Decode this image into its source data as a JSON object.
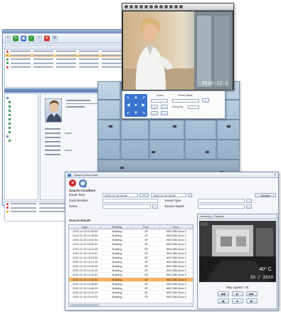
{
  "search_window": {
    "title": "Search Video Data",
    "search_condition_label": "Search Condition",
    "event_time_label": "Event Time",
    "time_from": "2010-12-15  00:00",
    "time_to": "2010-12-15  23:59",
    "card_number_label": "Card Number",
    "event_type_label": "Event Type",
    "name_label": "Name",
    "device_name_label": "Device Name",
    "search_button": "Search",
    "search_result_label": "Search Result",
    "columns": [
      "Date",
      "Building",
      "Floor",
      "Door"
    ],
    "rows": [
      [
        "2010-12-15 11:06:34",
        "Building",
        "GF",
        "IHDC380-Door 0"
      ],
      [
        "2010-12-15 11:06:59",
        "Building",
        "GF",
        "IHDC380-Door 0"
      ],
      [
        "2010-12-15 13:51:34",
        "Building",
        "GF",
        "IHDC380-Door 0"
      ],
      [
        "2010-12-15 13:51:34",
        "Building",
        "GF",
        "IHDC380-Door 0"
      ],
      [
        "2010-12-15 13:11:45",
        "Building",
        "GF",
        "IHDC380-Door 0"
      ],
      [
        "2010-12-15 13:13:51",
        "Building",
        "GF",
        "IHDC380-Door 0"
      ],
      [
        "2010-12-15 13:13:59",
        "Building",
        "GF",
        "IHDC380-Door 0"
      ],
      [
        "2010-12-15 13:17:19",
        "Building",
        "GF",
        "IHDC380-Door 0"
      ],
      [
        "2010-12-15 14:28:44",
        "Building",
        "GF",
        "IHDC380-Door 0"
      ],
      [
        "2010-12-15 14:31:44",
        "Building",
        "GF",
        "IHDC380-Door 0"
      ],
      [
        "2010-12-15 14:31:52",
        "Building",
        "GF",
        "IHDC380-Door 0"
      ],
      [
        "2010-12-15 14:31:52",
        "Building",
        "GF",
        "IHDC380-Door 0"
      ],
      [
        "2010-12-15 14:46:09",
        "Building",
        "GF",
        "IHDC380-Door 0"
      ],
      [
        "2010-12-15 14:46:13",
        "Building",
        "GF",
        "IHDC380-Door 0"
      ],
      [
        "2010-12-15 15:01:19",
        "Building",
        "GF",
        "IHDC380-Door 0"
      ],
      [
        "2010-12-15 16:01:03",
        "Building",
        "GF",
        "IHDC380-Door 0"
      ]
    ],
    "selected_row": 11
  },
  "playback": {
    "title": "Camera(c) - Playback",
    "temperature": "40° C",
    "clock": "33 / 2010",
    "play_speed": "Play Speed : x0",
    "controls_row1": [
      "◀◀",
      "▶",
      "▶▶"
    ],
    "controls_row2": [
      "◀|",
      "■",
      "|▶"
    ]
  },
  "video": {
    "timestamp": "2010-12-1"
  },
  "ptz": {
    "speed_label": "Speed",
    "preset_label": "Preset Name",
    "group_label": "Group No."
  },
  "colors": {
    "selected_row": "#f7b35c",
    "accent": "#3a74d1"
  }
}
